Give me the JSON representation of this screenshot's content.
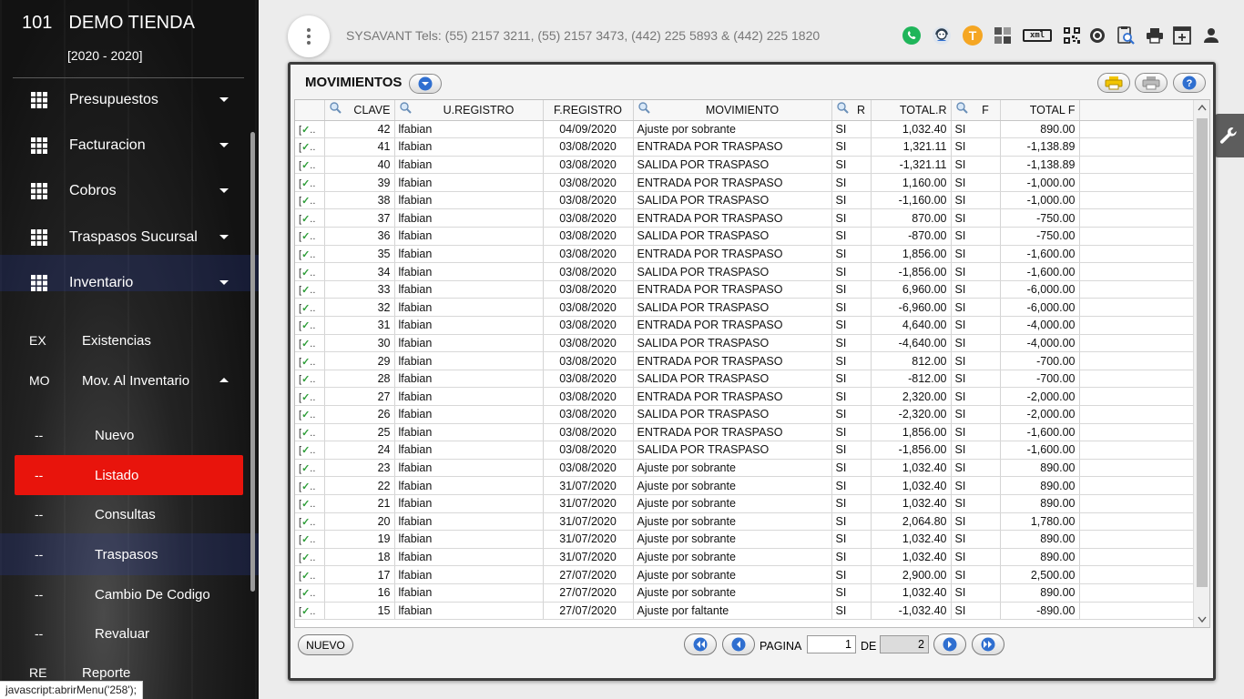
{
  "sidebar": {
    "store_number": "101",
    "store_name": "DEMO TIENDA",
    "years": "[2020 - 2020]",
    "main_items": [
      {
        "label": "Presupuestos"
      },
      {
        "label": "Facturacion"
      },
      {
        "label": "Cobros"
      },
      {
        "label": "Traspasos Sucursal"
      },
      {
        "label": "Inventario"
      }
    ],
    "sub_items": [
      {
        "abbr": "EX",
        "label": "Existencias"
      },
      {
        "abbr": "MO",
        "label": "Mov. Al Inventario"
      }
    ],
    "sub_sub_items": [
      {
        "abbr": "--",
        "label": "Nuevo"
      },
      {
        "abbr": "--",
        "label": "Listado"
      },
      {
        "abbr": "--",
        "label": "Consultas"
      },
      {
        "abbr": "--",
        "label": "Traspasos"
      },
      {
        "abbr": "--",
        "label": "Cambio De Codigo"
      },
      {
        "abbr": "--",
        "label": "Revaluar"
      }
    ],
    "last_item": {
      "abbr": "RE",
      "label": "Reporte"
    }
  },
  "status_bar": "javascript:abrirMenu('258');",
  "topbar": {
    "info": "SYSAVANT Tels: (55) 2157 3211, (55) 2157 3473, (442) 225 5893 & (442) 225 1820",
    "avatar_letter": "T",
    "xml_label": "xml"
  },
  "panel": {
    "title": "MOVIMIENTOS",
    "columns": [
      "CLAVE",
      "U.REGISTRO",
      "F.REGISTRO",
      "MOVIMIENTO",
      "R",
      "TOTAL.R",
      "F",
      "TOTAL F"
    ],
    "rows": [
      [
        "42",
        "lfabian",
        "04/09/2020",
        "Ajuste por sobrante",
        "SI",
        "1,032.40",
        "SI",
        "890.00"
      ],
      [
        "41",
        "lfabian",
        "03/08/2020",
        "ENTRADA POR TRASPASO",
        "SI",
        "1,321.11",
        "SI",
        "-1,138.89"
      ],
      [
        "40",
        "lfabian",
        "03/08/2020",
        "SALIDA POR TRASPASO",
        "SI",
        "-1,321.11",
        "SI",
        "-1,138.89"
      ],
      [
        "39",
        "lfabian",
        "03/08/2020",
        "ENTRADA POR TRASPASO",
        "SI",
        "1,160.00",
        "SI",
        "-1,000.00"
      ],
      [
        "38",
        "lfabian",
        "03/08/2020",
        "SALIDA POR TRASPASO",
        "SI",
        "-1,160.00",
        "SI",
        "-1,000.00"
      ],
      [
        "37",
        "lfabian",
        "03/08/2020",
        "ENTRADA POR TRASPASO",
        "SI",
        "870.00",
        "SI",
        "-750.00"
      ],
      [
        "36",
        "lfabian",
        "03/08/2020",
        "SALIDA POR TRASPASO",
        "SI",
        "-870.00",
        "SI",
        "-750.00"
      ],
      [
        "35",
        "lfabian",
        "03/08/2020",
        "ENTRADA POR TRASPASO",
        "SI",
        "1,856.00",
        "SI",
        "-1,600.00"
      ],
      [
        "34",
        "lfabian",
        "03/08/2020",
        "SALIDA POR TRASPASO",
        "SI",
        "-1,856.00",
        "SI",
        "-1,600.00"
      ],
      [
        "33",
        "lfabian",
        "03/08/2020",
        "ENTRADA POR TRASPASO",
        "SI",
        "6,960.00",
        "SI",
        "-6,000.00"
      ],
      [
        "32",
        "lfabian",
        "03/08/2020",
        "SALIDA POR TRASPASO",
        "SI",
        "-6,960.00",
        "SI",
        "-6,000.00"
      ],
      [
        "31",
        "lfabian",
        "03/08/2020",
        "ENTRADA POR TRASPASO",
        "SI",
        "4,640.00",
        "SI",
        "-4,000.00"
      ],
      [
        "30",
        "lfabian",
        "03/08/2020",
        "SALIDA POR TRASPASO",
        "SI",
        "-4,640.00",
        "SI",
        "-4,000.00"
      ],
      [
        "29",
        "lfabian",
        "03/08/2020",
        "ENTRADA POR TRASPASO",
        "SI",
        "812.00",
        "SI",
        "-700.00"
      ],
      [
        "28",
        "lfabian",
        "03/08/2020",
        "SALIDA POR TRASPASO",
        "SI",
        "-812.00",
        "SI",
        "-700.00"
      ],
      [
        "27",
        "lfabian",
        "03/08/2020",
        "ENTRADA POR TRASPASO",
        "SI",
        "2,320.00",
        "SI",
        "-2,000.00"
      ],
      [
        "26",
        "lfabian",
        "03/08/2020",
        "SALIDA POR TRASPASO",
        "SI",
        "-2,320.00",
        "SI",
        "-2,000.00"
      ],
      [
        "25",
        "lfabian",
        "03/08/2020",
        "ENTRADA POR TRASPASO",
        "SI",
        "1,856.00",
        "SI",
        "-1,600.00"
      ],
      [
        "24",
        "lfabian",
        "03/08/2020",
        "SALIDA POR TRASPASO",
        "SI",
        "-1,856.00",
        "SI",
        "-1,600.00"
      ],
      [
        "23",
        "lfabian",
        "03/08/2020",
        "Ajuste por sobrante",
        "SI",
        "1,032.40",
        "SI",
        "890.00"
      ],
      [
        "22",
        "lfabian",
        "31/07/2020",
        "Ajuste por sobrante",
        "SI",
        "1,032.40",
        "SI",
        "890.00"
      ],
      [
        "21",
        "lfabian",
        "31/07/2020",
        "Ajuste por sobrante",
        "SI",
        "1,032.40",
        "SI",
        "890.00"
      ],
      [
        "20",
        "lfabian",
        "31/07/2020",
        "Ajuste por sobrante",
        "SI",
        "2,064.80",
        "SI",
        "1,780.00"
      ],
      [
        "19",
        "lfabian",
        "31/07/2020",
        "Ajuste por sobrante",
        "SI",
        "1,032.40",
        "SI",
        "890.00"
      ],
      [
        "18",
        "lfabian",
        "31/07/2020",
        "Ajuste por sobrante",
        "SI",
        "1,032.40",
        "SI",
        "890.00"
      ],
      [
        "17",
        "lfabian",
        "27/07/2020",
        "Ajuste por sobrante",
        "SI",
        "2,900.00",
        "SI",
        "2,500.00"
      ],
      [
        "16",
        "lfabian",
        "27/07/2020",
        "Ajuste por sobrante",
        "SI",
        "1,032.40",
        "SI",
        "890.00"
      ],
      [
        "15",
        "lfabian",
        "27/07/2020",
        "Ajuste por faltante",
        "SI",
        "-1,032.40",
        "SI",
        "-890.00"
      ]
    ],
    "footer": {
      "new_label": "NUEVO",
      "page_label": "PAGINA",
      "page_value": "1",
      "of_label": "DE",
      "total_pages": "2"
    }
  },
  "colors": {
    "active_menu": "#e8140c",
    "accent_blue": "#2f6fd0"
  }
}
